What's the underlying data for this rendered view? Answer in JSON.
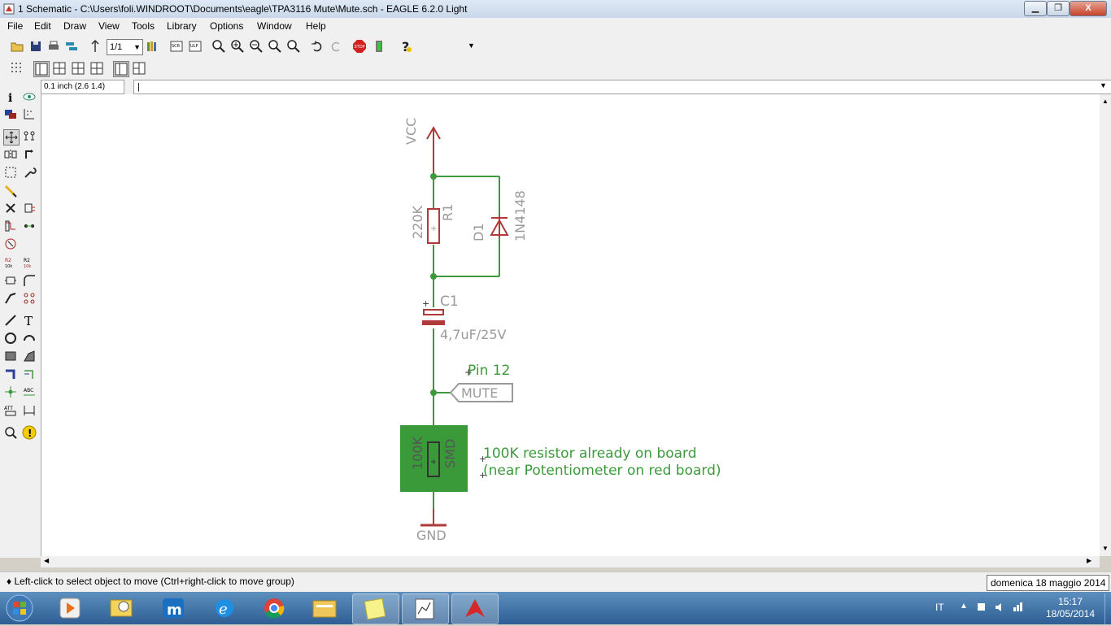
{
  "window": {
    "title": "1 Schematic - C:\\Users\\foli.WINDROOT\\Documents\\eagle\\TPA3116 Mute\\Mute.sch - EAGLE 6.2.0 Light",
    "minimize": "▁",
    "restore": "❐",
    "close": "X"
  },
  "menu": [
    "File",
    "Edit",
    "Draw",
    "View",
    "Tools",
    "Library",
    "Options",
    "Window",
    "Help"
  ],
  "toolbar": {
    "sheet_select": "1/1",
    "design_link_top": "design",
    "design_link_bottom": "link",
    "stop_label": "STOP"
  },
  "commandline": {
    "coordinates": "0.1 inch (2.6 1.4)",
    "input_value": ""
  },
  "schematic": {
    "vcc_label": "VCC",
    "r1_name": "R1",
    "r1_value": "220K",
    "d1_name": "D1",
    "d1_value": "1N4148",
    "c1_name": "C1",
    "c1_value": "4,7uF/25V",
    "c1_plus": "+",
    "pin_label": "Pin 12",
    "mute_label": "MUTE",
    "r_smd_value": "100K",
    "r_smd_name": "SMD",
    "note_line1": "100K resistor already on board",
    "note_line2": "(near Potentiometer on red board)",
    "gnd_label": "GND"
  },
  "status": {
    "text": "♦ Left-click to select object to move (Ctrl+right-click to move group)",
    "tooltip": "domenica 18 maggio 2014"
  },
  "taskbar": {
    "language": "IT",
    "time": "15:17",
    "date": "18/05/2014"
  },
  "colors": {
    "net": "#3c9a3c",
    "symbol": "#b03a3a",
    "label_gray": "#9a9a9a",
    "smd_pad": "#3a9a3a"
  }
}
